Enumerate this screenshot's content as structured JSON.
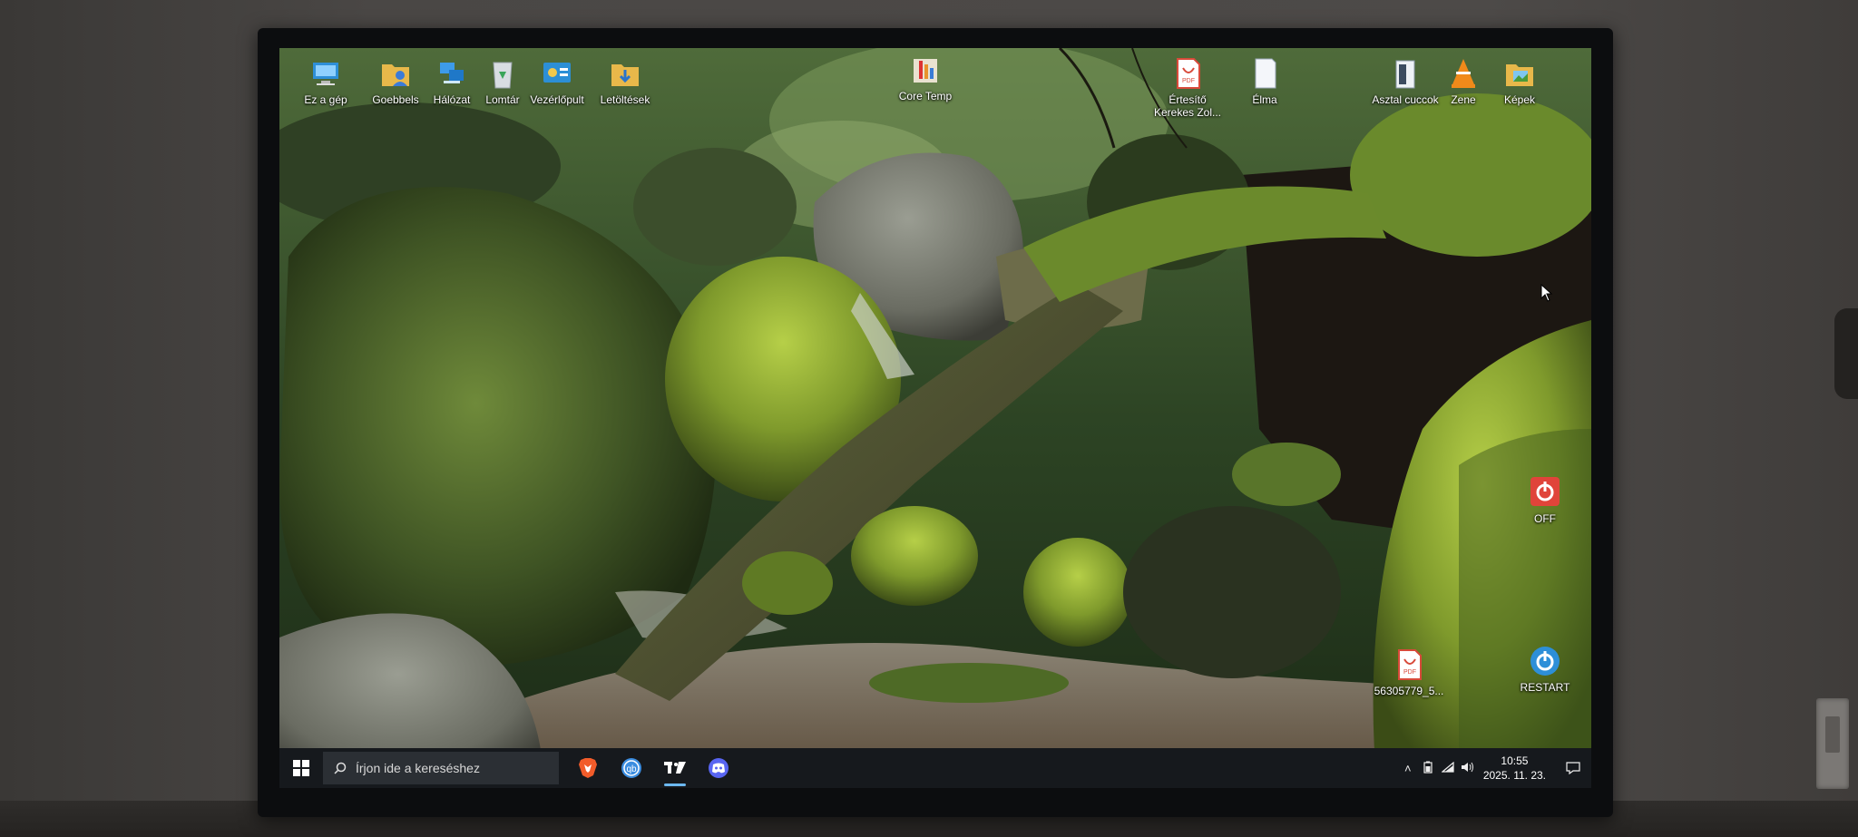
{
  "desktop": {
    "icons_top": [
      {
        "label": "Ez a gép",
        "icon": "pc-icon"
      },
      {
        "label": "Goebbels",
        "icon": "user-folder-icon"
      },
      {
        "label": "Hálózat",
        "icon": "network-icon"
      },
      {
        "label": "Lomtár",
        "icon": "recycle-bin-icon"
      },
      {
        "label": "Vezérlőpult",
        "icon": "control-panel-icon"
      },
      {
        "label": "Letöltések",
        "icon": "downloads-folder-icon"
      },
      {
        "label": "Core Temp",
        "icon": "core-temp-icon"
      },
      {
        "label": "Értesítő Kerekes Zol...",
        "icon": "pdf-icon"
      },
      {
        "label": "Élma",
        "icon": "document-icon"
      },
      {
        "label": "Asztal cuccok",
        "icon": "folder-shortcut-icon"
      },
      {
        "label": "Zene",
        "icon": "vlc-icon"
      },
      {
        "label": "Képek",
        "icon": "pictures-folder-icon"
      }
    ],
    "icons_right": [
      {
        "label": "OFF",
        "icon": "power-off-icon"
      },
      {
        "label": "56305779_5...",
        "icon": "pdf-icon"
      },
      {
        "label": "RESTART",
        "icon": "restart-icon"
      }
    ]
  },
  "taskbar": {
    "search_placeholder": "Írjon ide a kereséshez",
    "apps": [
      {
        "name": "Brave",
        "icon": "brave-icon"
      },
      {
        "name": "qBittorrent",
        "icon": "qbittorrent-icon"
      },
      {
        "name": "TradingView",
        "icon": "tradingview-icon",
        "active": true
      },
      {
        "name": "Discord",
        "icon": "discord-icon"
      }
    ],
    "time": "10:55",
    "date": "2025. 11. 23.",
    "tray_icons": [
      "chevron-up-icon",
      "battery-icon",
      "wifi-icon",
      "volume-icon"
    ]
  },
  "colors": {
    "taskbar_bg": "#16191d",
    "accent": "#6cb8f0",
    "power_red": "#e0443a",
    "restart_blue": "#2d8fd8"
  }
}
